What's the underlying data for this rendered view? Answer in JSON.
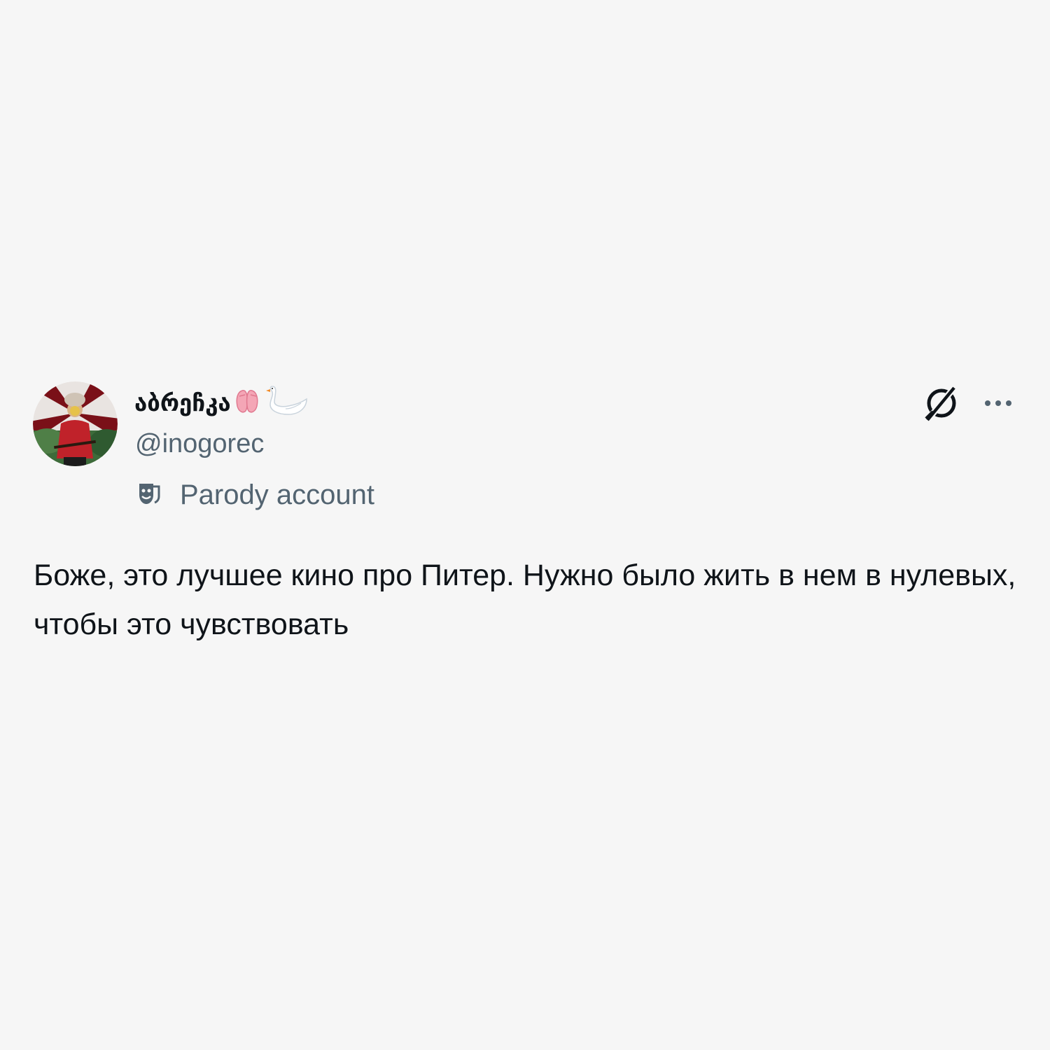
{
  "tweet": {
    "author": {
      "display_name": "აბრეჩკა",
      "display_name_emojis": [
        "ballet-shoes-emoji",
        "swan-emoji"
      ],
      "handle": "@inogorec",
      "avatar": "user-avatar"
    },
    "label": {
      "icon": "theater-mask-icon",
      "text": "Parody account"
    },
    "actions": {
      "grok_icon": "grok-icon",
      "more_icon": "more-dots-icon"
    },
    "body": "Боже, это лучшее кино про Питер. Нужно было жить в нем в нулевых, чтобы это чувствовать"
  },
  "colors": {
    "background": "#f6f6f6",
    "primary_text": "#0f1419",
    "secondary_text": "#536471"
  }
}
